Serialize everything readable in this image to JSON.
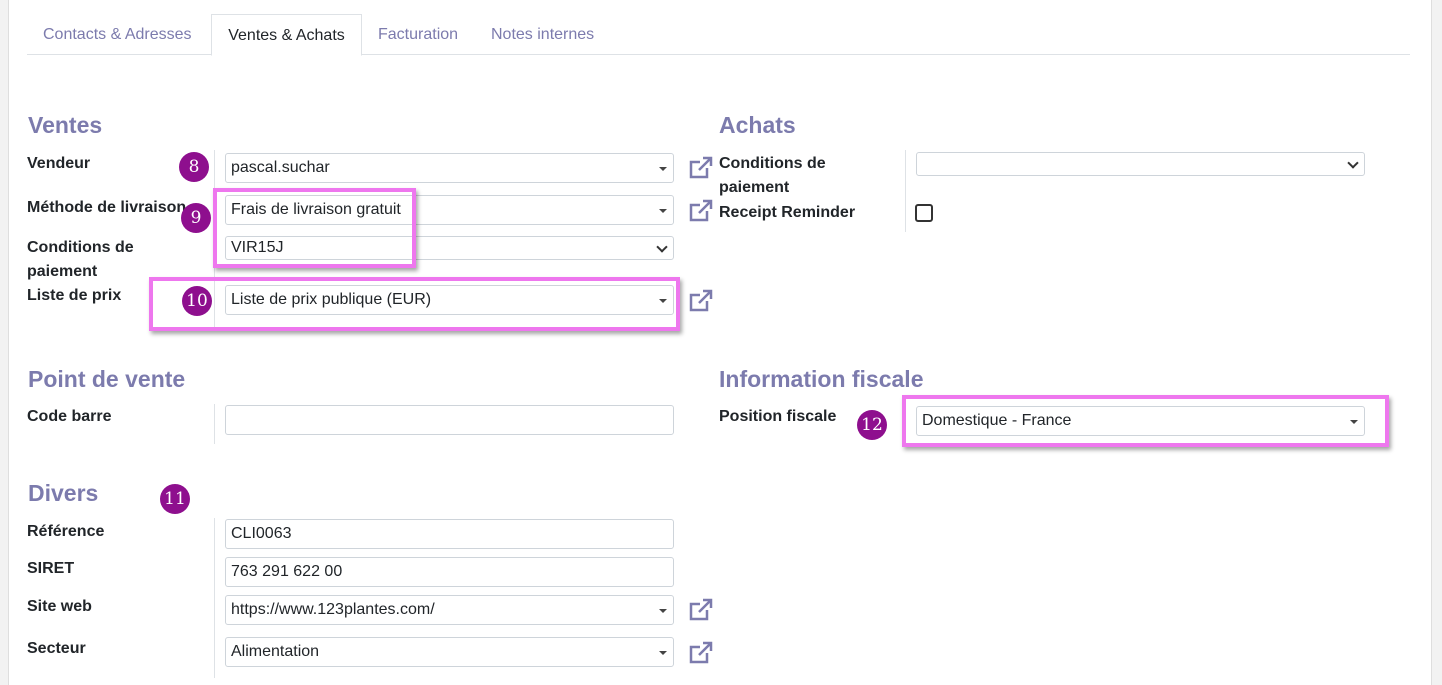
{
  "tabs": [
    {
      "label": "Contacts & Adresses"
    },
    {
      "label": "Ventes & Achats"
    },
    {
      "label": "Facturation"
    },
    {
      "label": "Notes internes"
    }
  ],
  "ventes": {
    "title": "Ventes",
    "vendeur_label": "Vendeur",
    "vendeur_value": "pascal.suchar",
    "livraison_label": "Méthode de livraison",
    "livraison_value": "Frais de livraison gratuit",
    "conditions_label_1": "Conditions de",
    "conditions_label_2": "paiement",
    "conditions_value": "VIR15J",
    "prix_label": "Liste de prix",
    "prix_value": "Liste de prix publique (EUR)"
  },
  "achats": {
    "title": "Achats",
    "conditions_label_1": "Conditions de",
    "conditions_label_2": "paiement",
    "conditions_value": "",
    "reminder_label": "Receipt Reminder"
  },
  "point_de_vente": {
    "title": "Point de vente",
    "code_barre_label": "Code barre",
    "code_barre_value": ""
  },
  "info_fiscale": {
    "title": "Information fiscale",
    "position_label": "Position fiscale",
    "position_value": "Domestique - France"
  },
  "divers": {
    "title": "Divers",
    "reference_label": "Référence",
    "reference_value": "CLI0063",
    "siret_label": "SIRET",
    "siret_value": "763 291 622 00",
    "site_label": "Site web",
    "site_value": "https://www.123plantes.com/",
    "secteur_label": "Secteur",
    "secteur_value": "Alimentation"
  },
  "badges": [
    "8",
    "9",
    "10",
    "11",
    "12"
  ],
  "colors": {
    "accent": "#7c7bad",
    "badge": "#8e0f8e",
    "highlight": "#ee77ee"
  }
}
